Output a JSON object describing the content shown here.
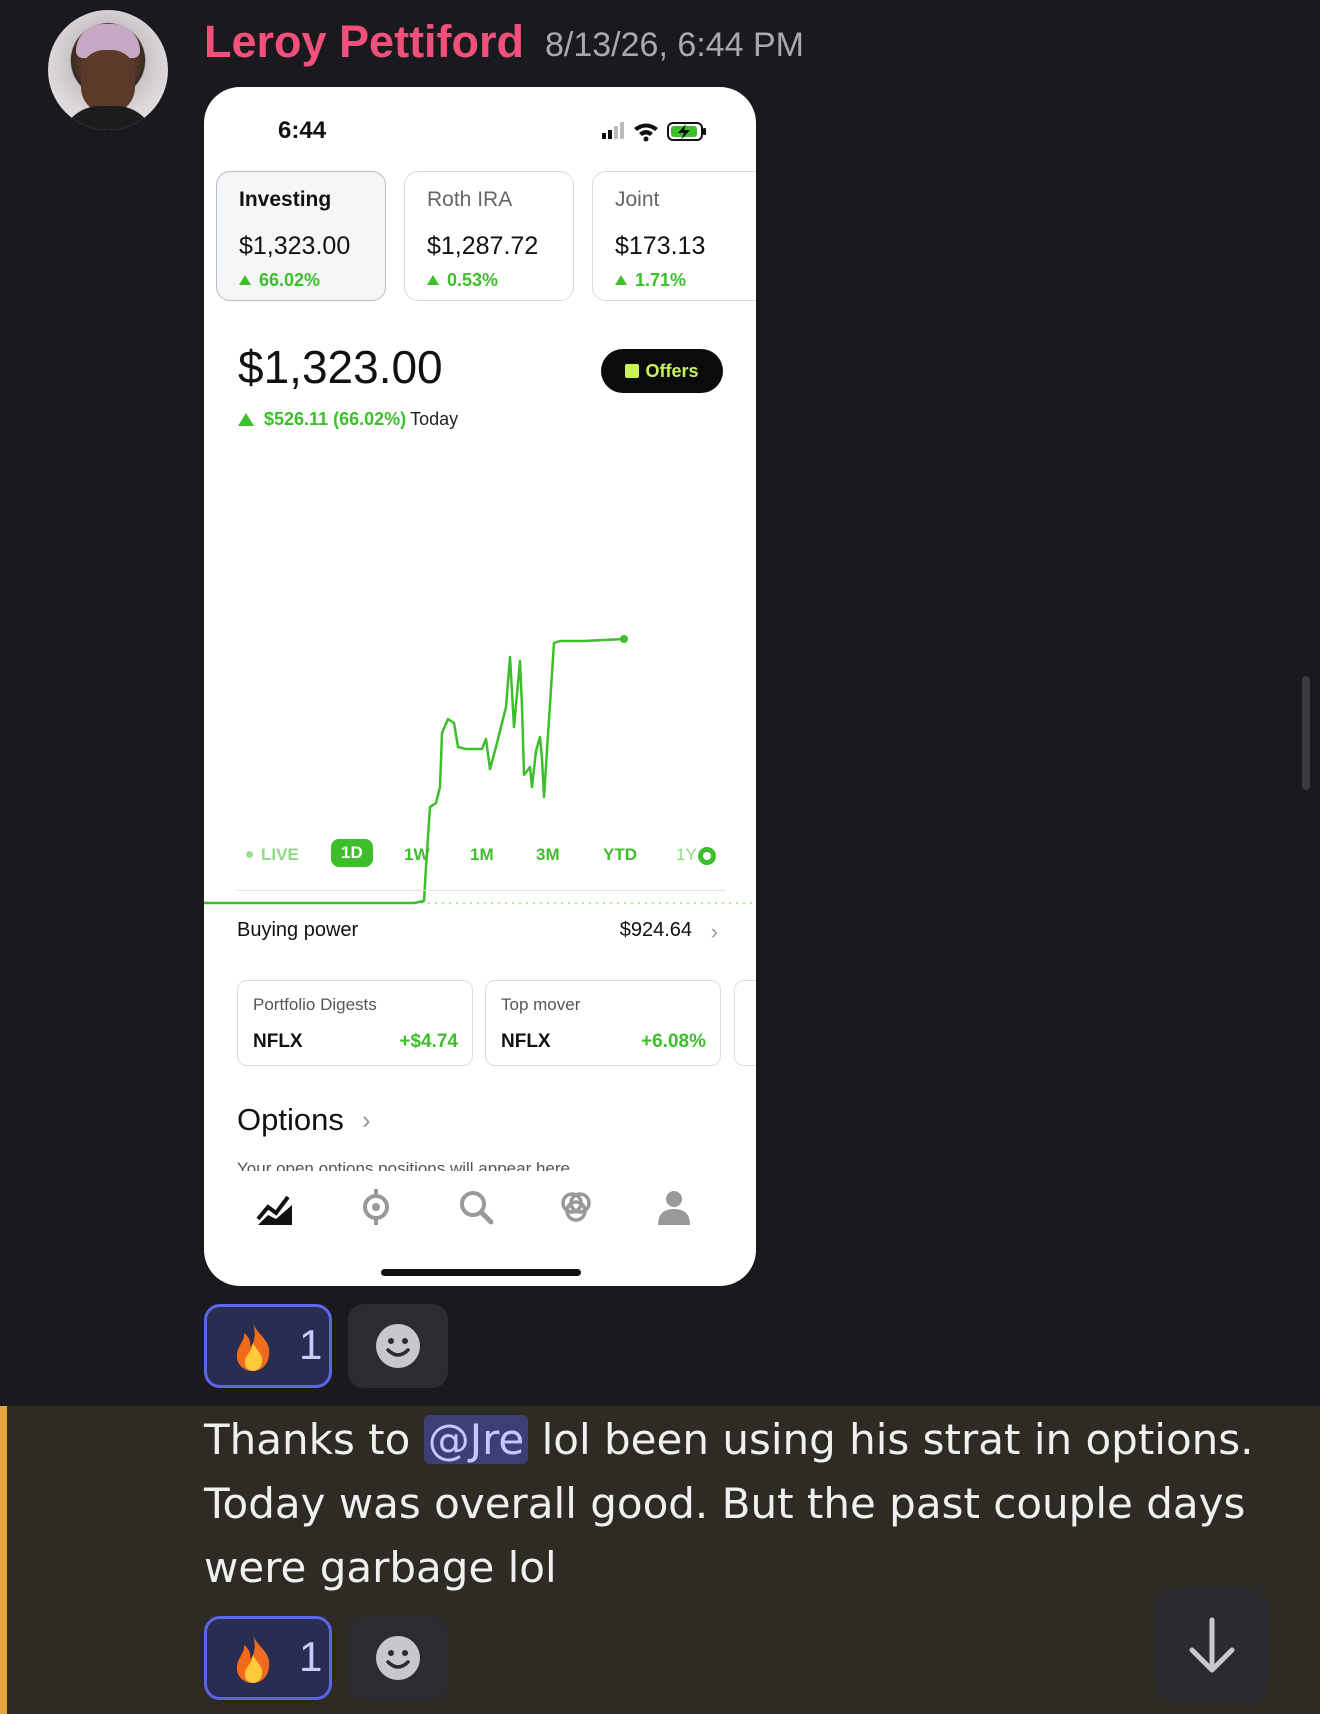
{
  "message": {
    "author": "Leroy Pettiford",
    "timestamp": "8/13/26, 6:44 PM",
    "text_before_mention": "Thanks to ",
    "mention": "@Jre",
    "text_after_mention": " lol been using his strat in options. Today was overall good. But the past couple days were garbage lol"
  },
  "reactions": [
    {
      "emoji": "fire-icon",
      "count": "1"
    },
    {
      "emoji": "fire-icon",
      "count": "1"
    }
  ],
  "phone": {
    "status_time": "6:44",
    "accounts": [
      {
        "name": "Investing",
        "value": "$1,323.00",
        "change": "66.02%"
      },
      {
        "name": "Roth IRA",
        "value": "$1,287.72",
        "change": "0.53%"
      },
      {
        "name": "Joint",
        "value": "$173.13",
        "change": "1.71%"
      }
    ],
    "portfolio_value": "$1,323.00",
    "offers_label": "Offers",
    "today_change": "$526.11 (66.02%)",
    "today_label": "Today",
    "ranges": [
      "LIVE",
      "1D",
      "1W",
      "1M",
      "3M",
      "YTD",
      "1Y"
    ],
    "selected_range": "1D",
    "buying_power_label": "Buying power",
    "buying_power_value": "$924.64",
    "cards": [
      {
        "title": "Portfolio Digests",
        "ticker": "NFLX",
        "value": "+$4.74"
      },
      {
        "title": "Top mover",
        "ticker": "NFLX",
        "value": "+6.08%"
      }
    ],
    "options_title": "Options",
    "options_subtitle": "Your open options positions will appear here"
  },
  "colors": {
    "username": "#f0507a",
    "gain_green": "#3cbf2a",
    "reaction_border": "#5a66e8",
    "highlight_bar": "#e8a33a"
  }
}
